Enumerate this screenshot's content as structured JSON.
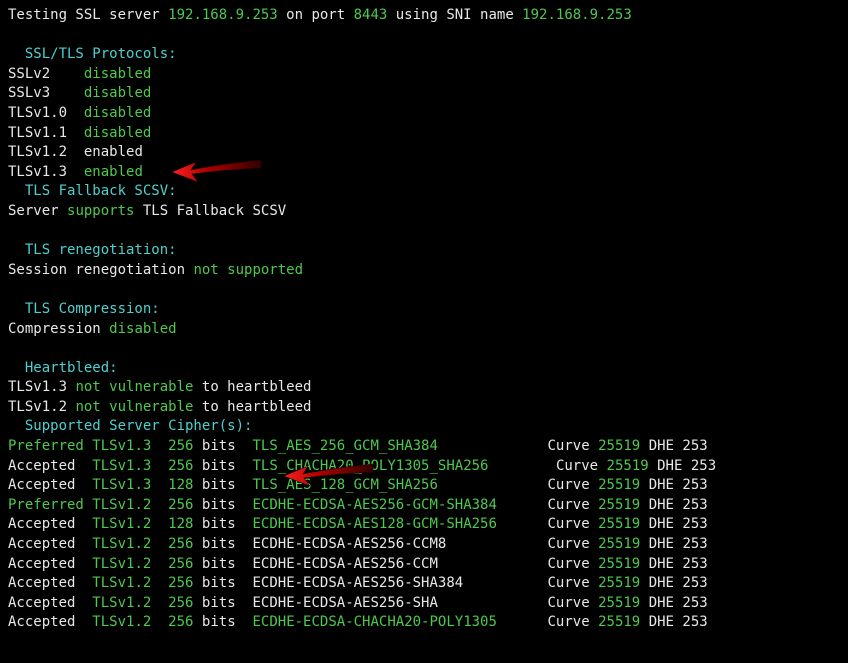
{
  "header": {
    "prefix": "Testing SSL server ",
    "host": "192.168.9.253",
    "mid": " on port ",
    "port": "8443",
    "mid2": " using SNI name ",
    "sni": "192.168.9.253"
  },
  "sections": {
    "protocols_title": "  SSL/TLS Protocols:",
    "fallback_title": "  TLS Fallback SCSV:",
    "reneg_title": "  TLS renegotiation:",
    "compress_title": "  TLS Compression:",
    "heartbleed_title": "  Heartbleed:",
    "ciphers_title": "  Supported Server Cipher(s):"
  },
  "protocols": [
    {
      "name": "SSLv2",
      "pad": "    ",
      "state": "disabled",
      "cls": "g"
    },
    {
      "name": "SSLv3",
      "pad": "    ",
      "state": "disabled",
      "cls": "g"
    },
    {
      "name": "TLSv1.0",
      "pad": "  ",
      "state": "disabled",
      "cls": "g"
    },
    {
      "name": "TLSv1.1",
      "pad": "  ",
      "state": "disabled",
      "cls": "g"
    },
    {
      "name": "TLSv1.2",
      "pad": "  ",
      "state": "enabled",
      "cls": "w"
    },
    {
      "name": "TLSv1.3",
      "pad": "  ",
      "state": "enabled",
      "cls": "g"
    }
  ],
  "fallback": {
    "prefix": "Server ",
    "supports": "supports",
    "suffix": " TLS Fallback SCSV"
  },
  "reneg": {
    "prefix": "Session renegotiation ",
    "state": "not supported"
  },
  "compress": {
    "prefix": "Compression ",
    "state": "disabled"
  },
  "heartbleed": [
    {
      "proto": "TLSv1.3",
      "state": "not vulnerable",
      "suffix": " to heartbleed"
    },
    {
      "proto": "TLSv1.2",
      "state": "not vulnerable",
      "suffix": " to heartbleed"
    }
  ],
  "ciphers": [
    {
      "status": "Preferred",
      "st_cls": "g",
      "proto": "TLSv1.3",
      "bits": "256",
      "cipher": "TLS_AES_256_GCM_SHA384",
      "c_cls": "g",
      "cpad": "             ",
      "curve": "25519",
      "dhe": "253"
    },
    {
      "status": "Accepted",
      "st_cls": "w",
      "proto": "TLSv1.3",
      "bits": "256",
      "cipher": "TLS_CHACHA20_POLY1305_SHA256",
      "c_cls": "g",
      "cpad": "        ",
      "curve": "25519",
      "dhe": "253"
    },
    {
      "status": "Accepted",
      "st_cls": "w",
      "proto": "TLSv1.3",
      "bits": "128",
      "cipher": "TLS_AES_128_GCM_SHA256",
      "c_cls": "g",
      "cpad": "             ",
      "curve": "25519",
      "dhe": "253"
    },
    {
      "status": "Preferred",
      "st_cls": "g",
      "proto": "TLSv1.2",
      "bits": "256",
      "cipher": "ECDHE-ECDSA-AES256-GCM-SHA384",
      "c_cls": "g",
      "cpad": "      ",
      "curve": "25519",
      "dhe": "253"
    },
    {
      "status": "Accepted",
      "st_cls": "w",
      "proto": "TLSv1.2",
      "bits": "128",
      "cipher": "ECDHE-ECDSA-AES128-GCM-SHA256",
      "c_cls": "g",
      "cpad": "      ",
      "curve": "25519",
      "dhe": "253"
    },
    {
      "status": "Accepted",
      "st_cls": "w",
      "proto": "TLSv1.2",
      "bits": "256",
      "cipher": "ECDHE-ECDSA-AES256-CCM8",
      "c_cls": "w",
      "cpad": "            ",
      "curve": "25519",
      "dhe": "253"
    },
    {
      "status": "Accepted",
      "st_cls": "w",
      "proto": "TLSv1.2",
      "bits": "256",
      "cipher": "ECDHE-ECDSA-AES256-CCM",
      "c_cls": "w",
      "cpad": "             ",
      "curve": "25519",
      "dhe": "253"
    },
    {
      "status": "Accepted",
      "st_cls": "w",
      "proto": "TLSv1.2",
      "bits": "256",
      "cipher": "ECDHE-ECDSA-AES256-SHA384",
      "c_cls": "w",
      "cpad": "          ",
      "curve": "25519",
      "dhe": "253"
    },
    {
      "status": "Accepted",
      "st_cls": "w",
      "proto": "TLSv1.2",
      "bits": "256",
      "cipher": "ECDHE-ECDSA-AES256-SHA",
      "c_cls": "w",
      "cpad": "             ",
      "curve": "25519",
      "dhe": "253"
    },
    {
      "status": "Accepted",
      "st_cls": "w",
      "proto": "TLSv1.2",
      "bits": "256",
      "cipher": "ECDHE-ECDSA-CHACHA20-POLY1305",
      "c_cls": "g",
      "cpad": "      ",
      "curve": "25519",
      "dhe": "253"
    }
  ],
  "labels": {
    "bits": "bits",
    "curve": "Curve",
    "dhe": "DHE"
  }
}
